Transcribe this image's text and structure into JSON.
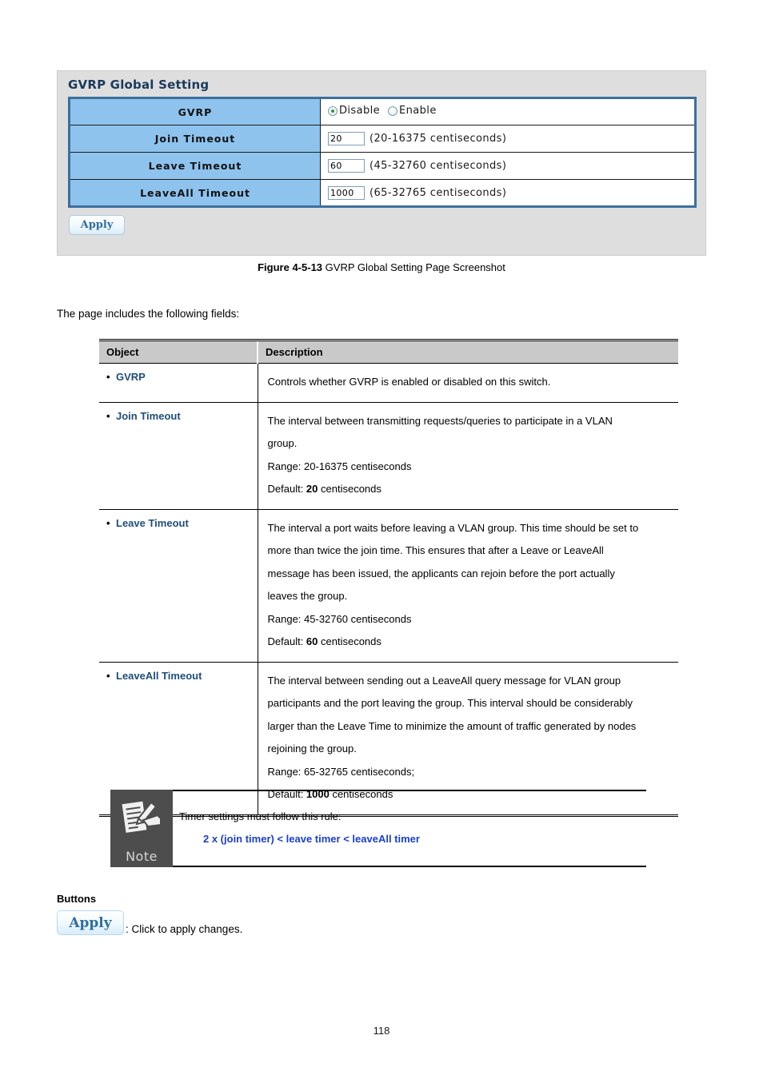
{
  "screenshot_panel": {
    "title": "GVRP Global Setting",
    "rows": [
      {
        "label": "GVRP",
        "type": "radio",
        "options": [
          {
            "label": "Disable",
            "selected": true
          },
          {
            "label": "Enable",
            "selected": false
          }
        ]
      },
      {
        "label": "Join Timeout",
        "type": "text",
        "value": "20",
        "hint": "(20-16375 centiseconds)"
      },
      {
        "label": "Leave Timeout",
        "type": "text",
        "value": "60",
        "hint": "(45-32760 centiseconds)"
      },
      {
        "label": "LeaveAll Timeout",
        "type": "text",
        "value": "1000",
        "hint": "(65-32765 centiseconds)"
      }
    ],
    "apply_label": "Apply",
    "colors": {
      "panel_bg": "#dedede",
      "label_cell": "#8ec3ee",
      "title_text": "#1b3a5c",
      "table_border": "#3c6f9e",
      "radio_selected_dot": "#1f9e2e"
    }
  },
  "figure": {
    "number": "Figure 4-5-13",
    "caption": "GVRP Global Setting Page Screenshot"
  },
  "intro_text": "The page includes the following fields:",
  "object_table": {
    "headers": {
      "object": "Object",
      "description": "Description"
    },
    "rows": [
      {
        "object": "GVRP",
        "description_lines": [
          {
            "text": "Controls whether GVRP is enabled or disabled on this switch."
          }
        ]
      },
      {
        "object": "Join Timeout",
        "description_lines": [
          {
            "text": "The interval between transmitting requests/queries to participate in a VLAN"
          },
          {
            "text": "group."
          },
          {
            "text": "Range: 20-16375 centiseconds"
          },
          {
            "prefix": "Default: ",
            "bold": "20",
            "suffix": " centiseconds"
          }
        ]
      },
      {
        "object": "Leave Timeout",
        "description_lines": [
          {
            "text": "The interval a port waits before leaving a VLAN group. This time should be set to"
          },
          {
            "text": "more than twice the join time. This ensures that after a Leave or LeaveAll"
          },
          {
            "text": "message has been issued, the applicants can rejoin before the port actually"
          },
          {
            "text": "leaves the group."
          },
          {
            "text": "Range: 45-32760 centiseconds"
          },
          {
            "prefix": "Default: ",
            "bold": "60",
            "suffix": " centiseconds"
          }
        ]
      },
      {
        "object": "LeaveAll Timeout",
        "description_lines": [
          {
            "text": "The interval between sending out a LeaveAll query message for VLAN group"
          },
          {
            "text": "participants and the port leaving the group. This interval should be considerably"
          },
          {
            "text": "larger than the Leave Time to minimize the amount of traffic generated by nodes"
          },
          {
            "text": "rejoining the group."
          },
          {
            "text": "Range: 65-32765 centiseconds;"
          },
          {
            "prefix": "Default: ",
            "bold": "1000",
            "suffix": " centiseconds"
          }
        ]
      }
    ],
    "object_label_color": "#1f4e79"
  },
  "note": {
    "icon_label": "Note",
    "line1": "Timer settings must follow this rule:",
    "line2": "2 x (join timer) < leave timer < leaveAll timer",
    "line2_color": "#1a3fcc"
  },
  "buttons_section": {
    "heading": "Buttons",
    "apply_label": "Apply",
    "apply_description": ": Click to apply changes."
  },
  "page_number": "118"
}
